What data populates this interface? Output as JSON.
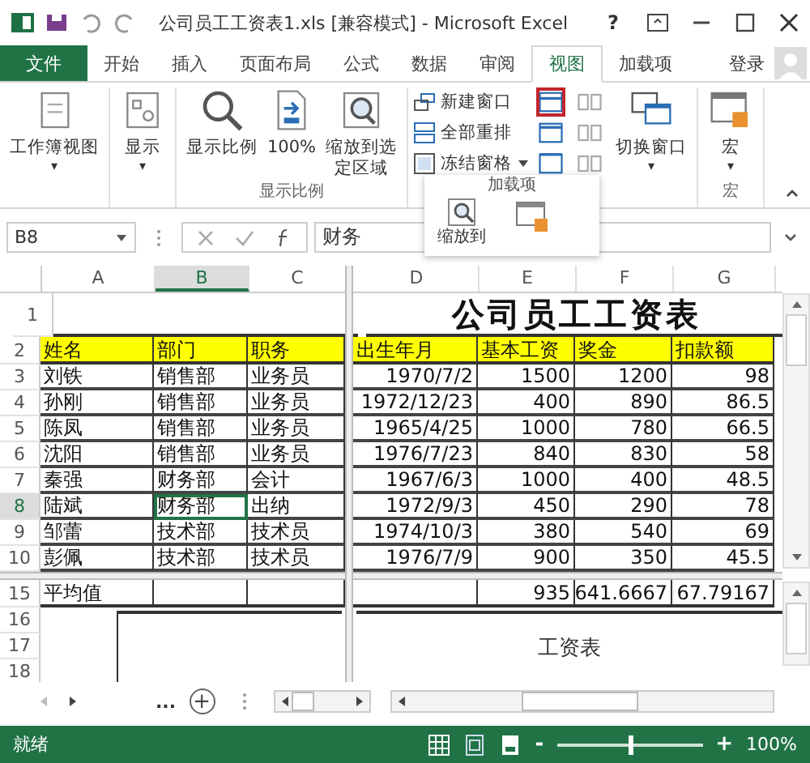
{
  "title_bar": {
    "title": "公司员工工资表1.xls  [兼容模式] - Microsoft Excel",
    "help": "?"
  },
  "ribbon_tabs": [
    {
      "label": "文件",
      "kind": "file",
      "selected": false
    },
    {
      "label": "开始",
      "kind": "tab",
      "selected": false
    },
    {
      "label": "插入",
      "kind": "tab",
      "selected": false
    },
    {
      "label": "页面布局",
      "kind": "tab",
      "selected": false
    },
    {
      "label": "公式",
      "kind": "tab",
      "selected": false
    },
    {
      "label": "数据",
      "kind": "tab",
      "selected": false
    },
    {
      "label": "审阅",
      "kind": "tab",
      "selected": false
    },
    {
      "label": "视图",
      "kind": "tab",
      "selected": true
    },
    {
      "label": "加载项",
      "kind": "tab",
      "selected": false
    }
  ],
  "account": {
    "label": "登录"
  },
  "ribbon": {
    "workbook_views": {
      "label": "工作簿视图",
      "dropdown": "▾"
    },
    "show": {
      "label": "显示",
      "dropdown": "▾"
    },
    "zoom_group": {
      "label": "显示比例",
      "buttons": [
        "显示比例",
        "100%",
        "缩放到选定区域"
      ]
    },
    "window_group": {
      "buttons": [
        {
          "label": "新建窗口",
          "dropdown": false
        },
        {
          "label": "全部重排",
          "dropdown": false
        },
        {
          "label": "冻结窗格",
          "dropdown": true
        }
      ],
      "small_icons": [
        {
          "highlighted": true
        },
        {
          "highlighted": false
        },
        {
          "highlighted": false
        },
        {
          "highlighted": false
        },
        {
          "highlighted": false
        },
        {
          "highlighted": false
        }
      ],
      "switch_windows": {
        "label": "切换窗口",
        "dropdown": "▾"
      }
    },
    "macro_group": {
      "label": "宏",
      "button": "宏",
      "dropdown": "▾"
    }
  },
  "floating_panel": {
    "label": "加载项",
    "zoom_label": "缩放到"
  },
  "formula_bar": {
    "name_box": "B8",
    "value": "财务"
  },
  "columns": [
    {
      "label": "A",
      "selected": false
    },
    {
      "label": "B",
      "selected": true
    },
    {
      "label": "C",
      "selected": false
    },
    {
      "label": "D",
      "selected": false
    },
    {
      "label": "E",
      "selected": false
    },
    {
      "label": "F",
      "selected": false
    },
    {
      "label": "G",
      "selected": false
    }
  ],
  "rows": [
    {
      "header": "1",
      "kind": "title",
      "selected": false,
      "title": "公司员工工资表"
    },
    {
      "header": "2",
      "kind": "heading",
      "selected": false,
      "cells": [
        "姓名",
        "部门",
        "职务",
        "出生年月",
        "基本工资",
        "奖金",
        "扣款额"
      ]
    },
    {
      "header": "3",
      "kind": "data",
      "selected": false,
      "cells": [
        "刘铁",
        "销售部",
        "业务员",
        "1970/7/2",
        "1500",
        "1200",
        "98"
      ]
    },
    {
      "header": "4",
      "kind": "data",
      "selected": false,
      "cells": [
        "孙刚",
        "销售部",
        "业务员",
        "1972/12/23",
        "400",
        "890",
        "86.5"
      ]
    },
    {
      "header": "5",
      "kind": "data",
      "selected": false,
      "cells": [
        "陈凤",
        "销售部",
        "业务员",
        "1965/4/25",
        "1000",
        "780",
        "66.5"
      ]
    },
    {
      "header": "6",
      "kind": "data",
      "selected": false,
      "cells": [
        "沈阳",
        "销售部",
        "业务员",
        "1976/7/23",
        "840",
        "830",
        "58"
      ]
    },
    {
      "header": "7",
      "kind": "data",
      "selected": false,
      "cells": [
        "秦强",
        "财务部",
        "会计",
        "1967/6/3",
        "1000",
        "400",
        "48.5"
      ]
    },
    {
      "header": "8",
      "kind": "data",
      "selected": true,
      "cells": [
        "陆斌",
        "财务部",
        "出纳",
        "1972/9/3",
        "450",
        "290",
        "78"
      ]
    },
    {
      "header": "9",
      "kind": "data",
      "selected": false,
      "cells": [
        "邹蕾",
        "技术部",
        "技术员",
        "1974/10/3",
        "380",
        "540",
        "69"
      ]
    },
    {
      "header": "10",
      "kind": "data",
      "selected": false,
      "cells": [
        "彭佩",
        "技术部",
        "技术员",
        "1976/7/9",
        "900",
        "350",
        "45.5"
      ]
    },
    {
      "header": "15",
      "kind": "summary",
      "selected": false,
      "cells": [
        "平均值",
        "",
        "",
        "",
        "935",
        "641.6667",
        "67.79167"
      ]
    },
    {
      "header": "16",
      "kind": "blank",
      "selected": false
    },
    {
      "header": "17",
      "kind": "blank",
      "selected": false
    },
    {
      "header": "18",
      "kind": "blank",
      "selected": false
    }
  ],
  "embedded_chart": {
    "title": "工资表"
  },
  "sheet_bar": {
    "more": "...",
    "add": "+"
  },
  "status_bar": {
    "status": "就绪",
    "zoom_out": "-",
    "zoom_in": "+",
    "zoom": "100%",
    "level": 0.5
  }
}
